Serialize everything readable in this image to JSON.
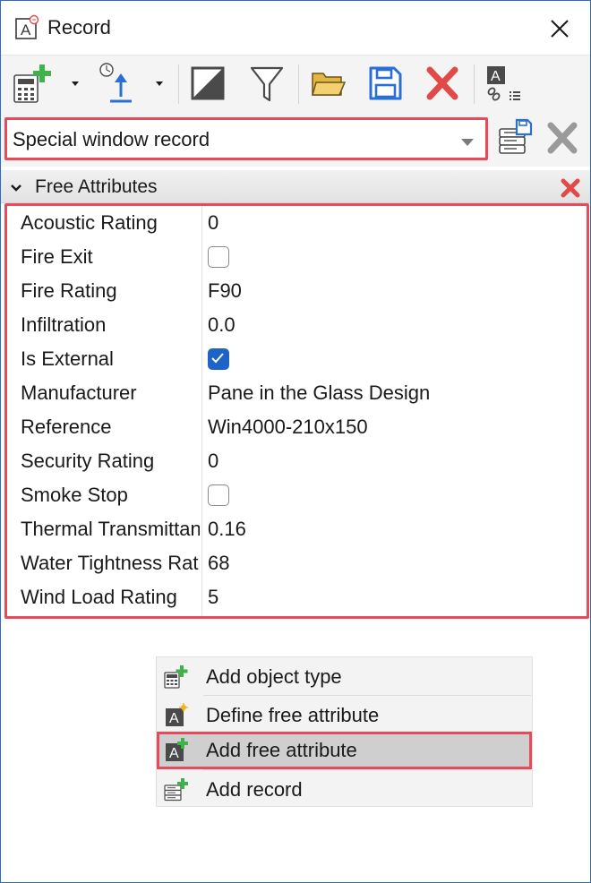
{
  "window": {
    "title": "Record",
    "icons": {
      "app": "attribute-record-icon",
      "close": "close-icon"
    }
  },
  "toolbar": {
    "buttons": [
      {
        "name": "add-object-type",
        "icon": "calculator-add-icon",
        "has_dropdown": true
      },
      {
        "name": "push-up",
        "icon": "clock-arrow-up-icon",
        "has_dropdown": true
      },
      {
        "name": "select-style",
        "icon": "half-square-icon",
        "has_dropdown": false
      },
      {
        "name": "filter",
        "icon": "funnel-icon",
        "has_dropdown": false
      },
      {
        "name": "open",
        "icon": "folder-open-icon",
        "has_dropdown": false
      },
      {
        "name": "save",
        "icon": "floppy-disk-icon",
        "has_dropdown": false
      },
      {
        "name": "delete",
        "icon": "red-x-icon",
        "has_dropdown": false
      },
      {
        "name": "link-attributes",
        "icon": "attribute-link-list-icon",
        "has_dropdown": false
      }
    ]
  },
  "record_selector": {
    "selected": "Special window record",
    "icons": {
      "save_record": "database-save-icon",
      "remove_record": "gray-x-icon"
    }
  },
  "attribute_group": {
    "title": "Free Attributes",
    "icons": {
      "collapse": "chevron-down-icon",
      "remove": "red-x-small-icon"
    },
    "rows": [
      {
        "name": "Acoustic Rating",
        "type": "text",
        "value": "0"
      },
      {
        "name": "Fire Exit",
        "type": "checkbox",
        "checked": false
      },
      {
        "name": "Fire Rating",
        "type": "text",
        "value": "F90"
      },
      {
        "name": "Infiltration",
        "type": "text",
        "value": "0.0"
      },
      {
        "name": "Is External",
        "type": "checkbox",
        "checked": true
      },
      {
        "name": "Manufacturer",
        "type": "text",
        "value": "Pane in the Glass Design"
      },
      {
        "name": "Reference",
        "type": "text",
        "value": "Win4000-210x150"
      },
      {
        "name": "Security Rating",
        "type": "text",
        "value": "0"
      },
      {
        "name": "Smoke Stop",
        "type": "checkbox",
        "checked": false
      },
      {
        "name": "Thermal Transmittance",
        "type": "text",
        "value": "0.16"
      },
      {
        "name": "Water Tightness Rating",
        "type": "text",
        "value": "68"
      },
      {
        "name": "Wind Load Rating",
        "type": "text",
        "value": "5"
      }
    ]
  },
  "context_menu": {
    "items": [
      {
        "label": "Add object type",
        "icon": "calculator-add-icon",
        "highlighted": false
      },
      {
        "label": "Define free attribute",
        "icon": "attribute-star-icon",
        "highlighted": false
      },
      {
        "label": "Add free attribute",
        "icon": "attribute-add-icon",
        "highlighted": true
      },
      {
        "label": "Add record",
        "icon": "database-add-icon",
        "highlighted": false
      }
    ]
  },
  "colors": {
    "highlight_frame": "#e84a5a",
    "checkbox_checked": "#1e63c8",
    "window_border": "#2b6cc4",
    "add_green": "#3fb24a",
    "delete_red": "#e24a4a",
    "save_blue": "#2a6fd6"
  }
}
